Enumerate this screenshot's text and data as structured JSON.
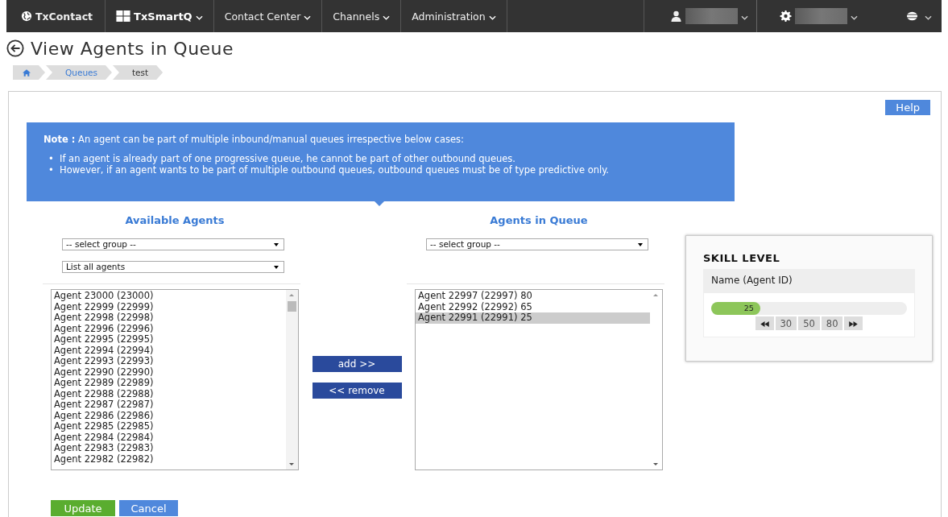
{
  "navbar": {
    "brand": "TxContact",
    "menus": [
      {
        "label": "TxSmartQ",
        "kind": "app"
      },
      {
        "label": "Contact Center",
        "kind": "menu"
      },
      {
        "label": "Channels",
        "kind": "menu"
      },
      {
        "label": "Administration",
        "kind": "menu"
      }
    ]
  },
  "page_title": "View Agents in Queue",
  "breadcrumb": [
    {
      "label": "Queues",
      "kind": "link"
    },
    {
      "label": "test",
      "kind": "current"
    }
  ],
  "help_button": "Help",
  "note": {
    "lead": "**Note :** An agent can be part of multiple inbound/manual queues irrespective below cases:",
    "items": [
      {
        "bullet": "•",
        "text": "If an agent is already part of one progressive queue, he cannot be part of other outbound queues."
      },
      {
        "bullet": "•",
        "text": "However, if an agent wants to be part of multiple outbound queues, outbound queues must be of type predictive only."
      }
    ]
  },
  "available": {
    "heading": "Available Agents",
    "group_select": "-- select group --",
    "filter_select": "List all agents",
    "agents": [
      {
        "label": "Agent 23000 (23000)",
        "selected": false
      },
      {
        "label": "Agent 22999 (22999)",
        "selected": false
      },
      {
        "label": "Agent 22998 (22998)",
        "selected": false
      },
      {
        "label": "Agent 22996 (22996)",
        "selected": false
      },
      {
        "label": "Agent 22995 (22995)",
        "selected": false
      },
      {
        "label": "Agent 22994 (22994)",
        "selected": false
      },
      {
        "label": "Agent 22993 (22993)",
        "selected": false
      },
      {
        "label": "Agent 22990 (22990)",
        "selected": false
      },
      {
        "label": "Agent 22989 (22989)",
        "selected": false
      },
      {
        "label": "Agent 22988 (22988)",
        "selected": false
      },
      {
        "label": "Agent 22987 (22987)",
        "selected": false
      },
      {
        "label": "Agent 22986 (22986)",
        "selected": false
      },
      {
        "label": "Agent 22985 (22985)",
        "selected": false
      },
      {
        "label": "Agent 22984 (22984)",
        "selected": false
      },
      {
        "label": "Agent 22983 (22983)",
        "selected": false
      },
      {
        "label": "Agent 22982 (22982)",
        "selected": false
      }
    ]
  },
  "add_button": "add >>",
  "remove_button": "<< remove",
  "in_queue": {
    "heading": "Agents in Queue",
    "group_select": "-- select group --",
    "agents": [
      {
        "label": "Agent 22997 (22997) 80",
        "selected": false
      },
      {
        "label": "Agent 22992 (22992) 65",
        "selected": false
      },
      {
        "label": "Agent 22991 (22991) 25",
        "selected": true
      }
    ]
  },
  "skill_level": {
    "title": "SKILL LEVEL",
    "column": "Name (Agent ID)",
    "level": 0.25,
    "reading": "25",
    "presets": [
      "30",
      "50",
      "80"
    ]
  },
  "actions": [
    {
      "label": "Update",
      "kind": "primary"
    },
    {
      "label": "Cancel",
      "kind": "secondary"
    }
  ]
}
